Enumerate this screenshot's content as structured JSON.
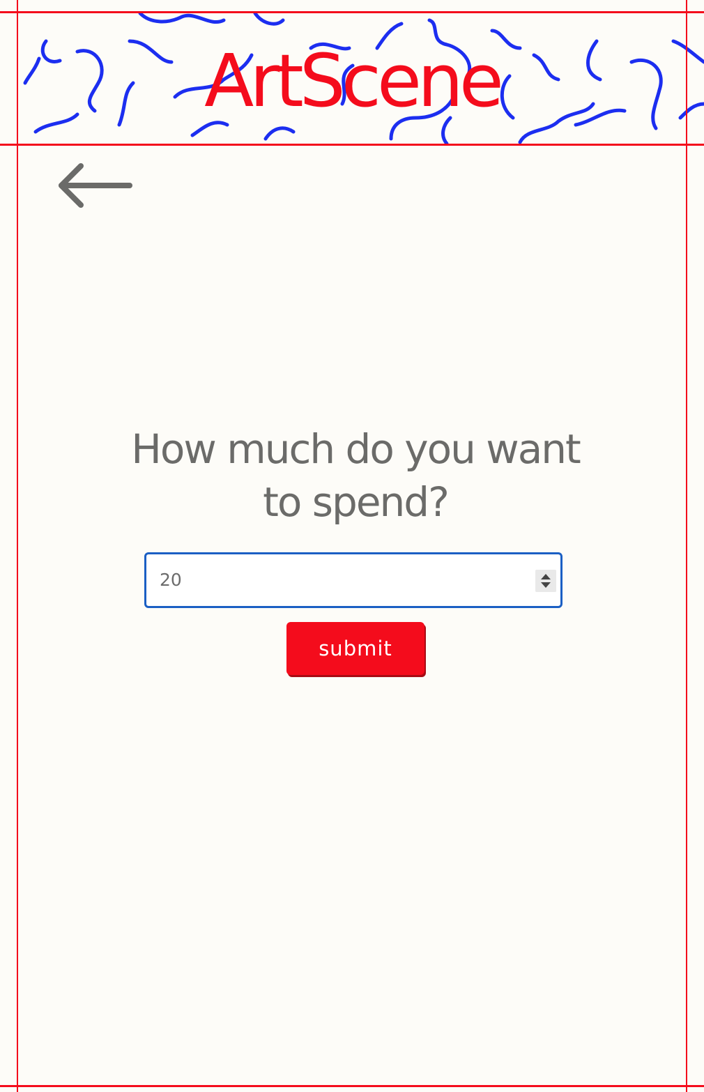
{
  "header": {
    "logo": "ArtScene"
  },
  "navigation": {
    "back_icon": "arrow-left-icon"
  },
  "form": {
    "question": "How much do you want to spend?",
    "amount_value": "20",
    "submit_label": "submit"
  },
  "colors": {
    "brand_red": "#f40c1c",
    "squiggle_blue": "#1c2ef0",
    "text_gray": "#6b6b69",
    "input_border_blue": "#1b5fc4",
    "background": "#fdfcf8"
  }
}
